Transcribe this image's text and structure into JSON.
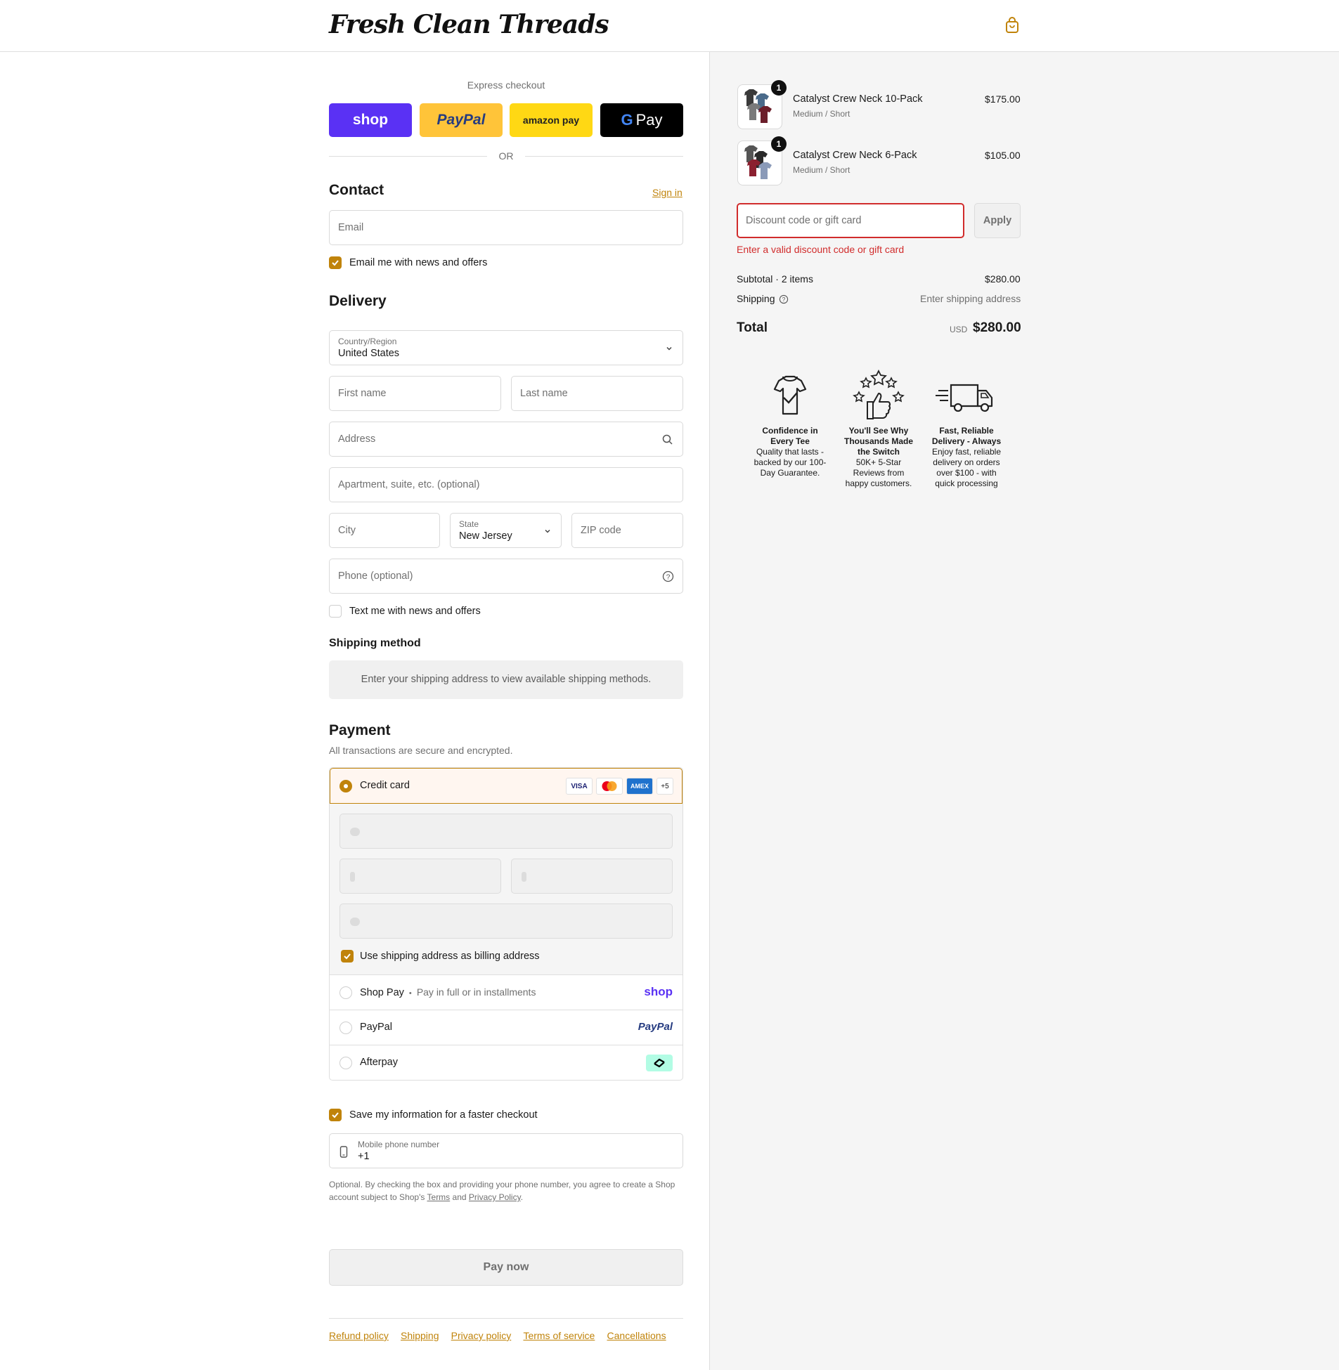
{
  "header": {
    "logo": "Fresh Clean Threads",
    "cart_icon": "shopping-bag-icon"
  },
  "express": {
    "label": "Express checkout",
    "shop_pay": "shop",
    "paypal": "PayPal",
    "amazon_pay": "amazon pay",
    "google_pay": "Pay",
    "or": "OR"
  },
  "contact": {
    "title": "Contact",
    "sign_in": "Sign in",
    "email_placeholder": "Email",
    "newsletter_label": "Email me with news and offers",
    "newsletter_checked": true
  },
  "delivery": {
    "title": "Delivery",
    "country_label": "Country/Region",
    "country_value": "United States",
    "first_name": "First name",
    "last_name": "Last name",
    "address": "Address",
    "apartment": "Apartment, suite, etc. (optional)",
    "city": "City",
    "state_label": "State",
    "state_value": "New Jersey",
    "zip": "ZIP code",
    "phone": "Phone (optional)",
    "sms_label": "Text me with news and offers",
    "sms_checked": false
  },
  "shipping_method": {
    "title": "Shipping method",
    "message": "Enter your shipping address to view available shipping methods."
  },
  "payment": {
    "title": "Payment",
    "subtitle": "All transactions are secure and encrypted.",
    "credit_card_label": "Credit card",
    "card_brands": [
      "VISA",
      "mastercard",
      "AMEX",
      "+5"
    ],
    "billing_label": "Use shipping address as billing address",
    "billing_checked": true,
    "shop_pay_label": "Shop Pay",
    "shop_pay_sep": "•",
    "shop_pay_desc": "Pay in full or in installments",
    "shop_pay_logo": "shop",
    "paypal_label": "PayPal",
    "paypal_logo": "PayPal",
    "afterpay_label": "Afterpay"
  },
  "save_info": {
    "label": "Save my information for a faster checkout",
    "checked": true,
    "phone_label": "Mobile phone number",
    "phone_value": "+1",
    "legal_pre": "Optional. By checking the box and providing your phone number, you agree to create a Shop account subject to Shop's",
    "terms": "Terms",
    "and": "and",
    "privacy": "Privacy Policy",
    "period": "."
  },
  "pay_now": "Pay now",
  "footer": [
    "Refund policy",
    "Shipping",
    "Privacy policy",
    "Terms of service",
    "Cancellations"
  ],
  "summary": {
    "items": [
      {
        "name": "Catalyst Crew Neck 10-Pack",
        "variant": "Medium / Short",
        "price": "$175.00",
        "qty": "1"
      },
      {
        "name": "Catalyst Crew Neck 6-Pack",
        "variant": "Medium / Short",
        "price": "$105.00",
        "qty": "1"
      }
    ],
    "discount_placeholder": "Discount code or gift card",
    "apply": "Apply",
    "discount_error": "Enter a valid discount code or gift card",
    "subtotal_label": "Subtotal · 2 items",
    "subtotal_value": "$280.00",
    "shipping_label": "Shipping",
    "shipping_value": "Enter shipping address",
    "total_label": "Total",
    "currency": "USD",
    "total_value": "$280.00"
  },
  "features": [
    {
      "icon": "tshirt-check-icon",
      "title": "Confidence in Every Tee",
      "text": "Quality that lasts - backed by our 100-Day Guarantee."
    },
    {
      "icon": "thumbs-up-stars-icon",
      "title": "You'll See Why Thousands Made the Switch",
      "text": "50K+ 5-Star Reviews from happy customers."
    },
    {
      "icon": "delivery-truck-icon",
      "title": "Fast, Reliable Delivery - Always",
      "text": "Enjoy fast, reliable delivery on orders over $100 - with quick processing"
    }
  ],
  "colors": {
    "accent": "#c0830a",
    "error": "#d12c2c",
    "shop_pay": "#5a31f4",
    "paypal": "#ffc439",
    "amazon": "#ffd814",
    "google_pay": "#000000"
  }
}
